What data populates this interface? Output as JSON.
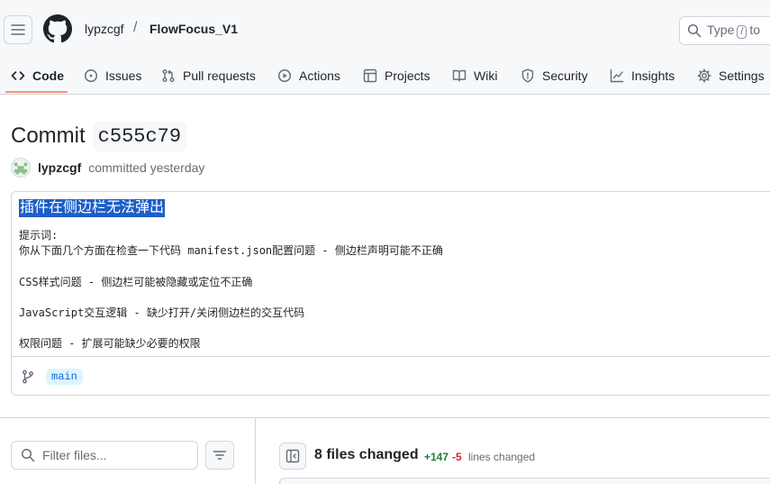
{
  "header": {
    "owner": "lypzcgf",
    "separator": "/",
    "repo": "FlowFocus_V1",
    "search_prefix": "Type",
    "search_key": "/",
    "search_suffix": "to"
  },
  "tabs": [
    {
      "label": "Code",
      "icon": "code-icon",
      "active": true
    },
    {
      "label": "Issues",
      "icon": "issue-icon"
    },
    {
      "label": "Pull requests",
      "icon": "pull-request-icon"
    },
    {
      "label": "Actions",
      "icon": "play-icon"
    },
    {
      "label": "Projects",
      "icon": "table-icon"
    },
    {
      "label": "Wiki",
      "icon": "book-icon"
    },
    {
      "label": "Security",
      "icon": "shield-icon"
    },
    {
      "label": "Insights",
      "icon": "graph-icon"
    },
    {
      "label": "Settings",
      "icon": "gear-icon"
    }
  ],
  "commit": {
    "title_word": "Commit",
    "sha": "c555c79",
    "author": "lypzcgf",
    "meta": "committed yesterday",
    "message_title": "插件在侧边栏无法弹出",
    "message_lines": [
      "提示词:",
      "你从下面几个方面在检查一下代码 manifest.json配置问题 - 侧边栏声明可能不正确",
      "",
      "CSS样式问题 - 侧边栏可能被隐藏或定位不正确",
      "",
      "JavaScript交互逻辑 - 缺少打开/关闭侧边栏的交互代码",
      "",
      "权限问题 - 扩展可能缺少必要的权限"
    ],
    "branch": "main"
  },
  "files": {
    "filter_placeholder": "Filter files...",
    "changed_label": "8 files changed",
    "additions": "+147",
    "deletions": "-5",
    "lines_label": "lines changed"
  },
  "colors": {
    "accent_underline": "#fd8c73",
    "link_blue": "#0969da",
    "addition_green": "#1a7f37",
    "deletion_red": "#d1242f",
    "selection_blue": "#1c5ec7"
  }
}
